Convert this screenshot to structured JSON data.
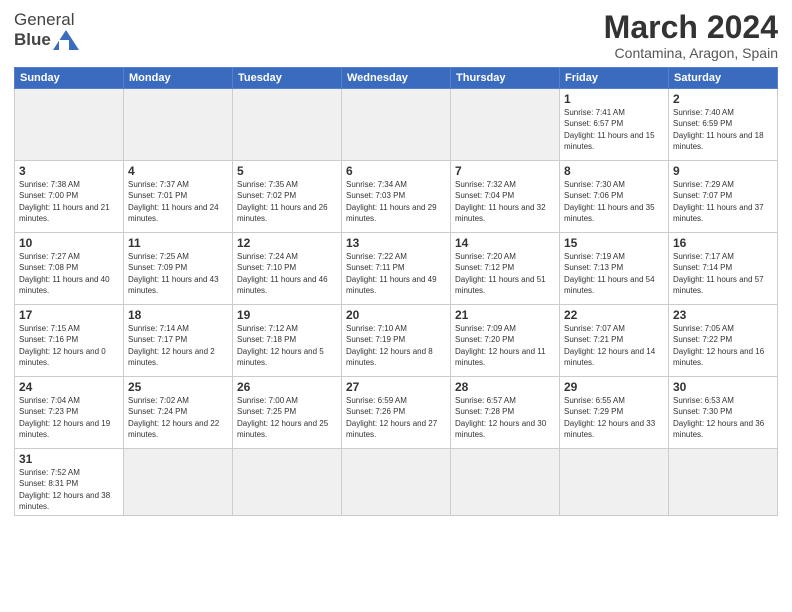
{
  "header": {
    "logo_general": "General",
    "logo_blue": "Blue",
    "month_title": "March 2024",
    "subtitle": "Contamina, Aragon, Spain"
  },
  "days_of_week": [
    "Sunday",
    "Monday",
    "Tuesday",
    "Wednesday",
    "Thursday",
    "Friday",
    "Saturday"
  ],
  "weeks": [
    [
      {
        "day": "",
        "empty": true
      },
      {
        "day": "",
        "empty": true
      },
      {
        "day": "",
        "empty": true
      },
      {
        "day": "",
        "empty": true
      },
      {
        "day": "",
        "empty": true
      },
      {
        "day": "1",
        "sunrise": "7:41 AM",
        "sunset": "6:57 PM",
        "daylight": "11 hours and 15 minutes."
      },
      {
        "day": "2",
        "sunrise": "7:40 AM",
        "sunset": "6:59 PM",
        "daylight": "11 hours and 18 minutes."
      }
    ],
    [
      {
        "day": "3",
        "sunrise": "7:38 AM",
        "sunset": "7:00 PM",
        "daylight": "11 hours and 21 minutes."
      },
      {
        "day": "4",
        "sunrise": "7:37 AM",
        "sunset": "7:01 PM",
        "daylight": "11 hours and 24 minutes."
      },
      {
        "day": "5",
        "sunrise": "7:35 AM",
        "sunset": "7:02 PM",
        "daylight": "11 hours and 26 minutes."
      },
      {
        "day": "6",
        "sunrise": "7:34 AM",
        "sunset": "7:03 PM",
        "daylight": "11 hours and 29 minutes."
      },
      {
        "day": "7",
        "sunrise": "7:32 AM",
        "sunset": "7:04 PM",
        "daylight": "11 hours and 32 minutes."
      },
      {
        "day": "8",
        "sunrise": "7:30 AM",
        "sunset": "7:06 PM",
        "daylight": "11 hours and 35 minutes."
      },
      {
        "day": "9",
        "sunrise": "7:29 AM",
        "sunset": "7:07 PM",
        "daylight": "11 hours and 37 minutes."
      }
    ],
    [
      {
        "day": "10",
        "sunrise": "7:27 AM",
        "sunset": "7:08 PM",
        "daylight": "11 hours and 40 minutes."
      },
      {
        "day": "11",
        "sunrise": "7:25 AM",
        "sunset": "7:09 PM",
        "daylight": "11 hours and 43 minutes."
      },
      {
        "day": "12",
        "sunrise": "7:24 AM",
        "sunset": "7:10 PM",
        "daylight": "11 hours and 46 minutes."
      },
      {
        "day": "13",
        "sunrise": "7:22 AM",
        "sunset": "7:11 PM",
        "daylight": "11 hours and 49 minutes."
      },
      {
        "day": "14",
        "sunrise": "7:20 AM",
        "sunset": "7:12 PM",
        "daylight": "11 hours and 51 minutes."
      },
      {
        "day": "15",
        "sunrise": "7:19 AM",
        "sunset": "7:13 PM",
        "daylight": "11 hours and 54 minutes."
      },
      {
        "day": "16",
        "sunrise": "7:17 AM",
        "sunset": "7:14 PM",
        "daylight": "11 hours and 57 minutes."
      }
    ],
    [
      {
        "day": "17",
        "sunrise": "7:15 AM",
        "sunset": "7:16 PM",
        "daylight": "12 hours and 0 minutes."
      },
      {
        "day": "18",
        "sunrise": "7:14 AM",
        "sunset": "7:17 PM",
        "daylight": "12 hours and 2 minutes."
      },
      {
        "day": "19",
        "sunrise": "7:12 AM",
        "sunset": "7:18 PM",
        "daylight": "12 hours and 5 minutes."
      },
      {
        "day": "20",
        "sunrise": "7:10 AM",
        "sunset": "7:19 PM",
        "daylight": "12 hours and 8 minutes."
      },
      {
        "day": "21",
        "sunrise": "7:09 AM",
        "sunset": "7:20 PM",
        "daylight": "12 hours and 11 minutes."
      },
      {
        "day": "22",
        "sunrise": "7:07 AM",
        "sunset": "7:21 PM",
        "daylight": "12 hours and 14 minutes."
      },
      {
        "day": "23",
        "sunrise": "7:05 AM",
        "sunset": "7:22 PM",
        "daylight": "12 hours and 16 minutes."
      }
    ],
    [
      {
        "day": "24",
        "sunrise": "7:04 AM",
        "sunset": "7:23 PM",
        "daylight": "12 hours and 19 minutes."
      },
      {
        "day": "25",
        "sunrise": "7:02 AM",
        "sunset": "7:24 PM",
        "daylight": "12 hours and 22 minutes."
      },
      {
        "day": "26",
        "sunrise": "7:00 AM",
        "sunset": "7:25 PM",
        "daylight": "12 hours and 25 minutes."
      },
      {
        "day": "27",
        "sunrise": "6:59 AM",
        "sunset": "7:26 PM",
        "daylight": "12 hours and 27 minutes."
      },
      {
        "day": "28",
        "sunrise": "6:57 AM",
        "sunset": "7:28 PM",
        "daylight": "12 hours and 30 minutes."
      },
      {
        "day": "29",
        "sunrise": "6:55 AM",
        "sunset": "7:29 PM",
        "daylight": "12 hours and 33 minutes."
      },
      {
        "day": "30",
        "sunrise": "6:53 AM",
        "sunset": "7:30 PM",
        "daylight": "12 hours and 36 minutes."
      }
    ],
    [
      {
        "day": "31",
        "sunrise": "7:52 AM",
        "sunset": "8:31 PM",
        "daylight": "12 hours and 38 minutes."
      },
      {
        "day": "",
        "empty": true
      },
      {
        "day": "",
        "empty": true
      },
      {
        "day": "",
        "empty": true
      },
      {
        "day": "",
        "empty": true
      },
      {
        "day": "",
        "empty": true
      },
      {
        "day": "",
        "empty": true
      }
    ]
  ]
}
